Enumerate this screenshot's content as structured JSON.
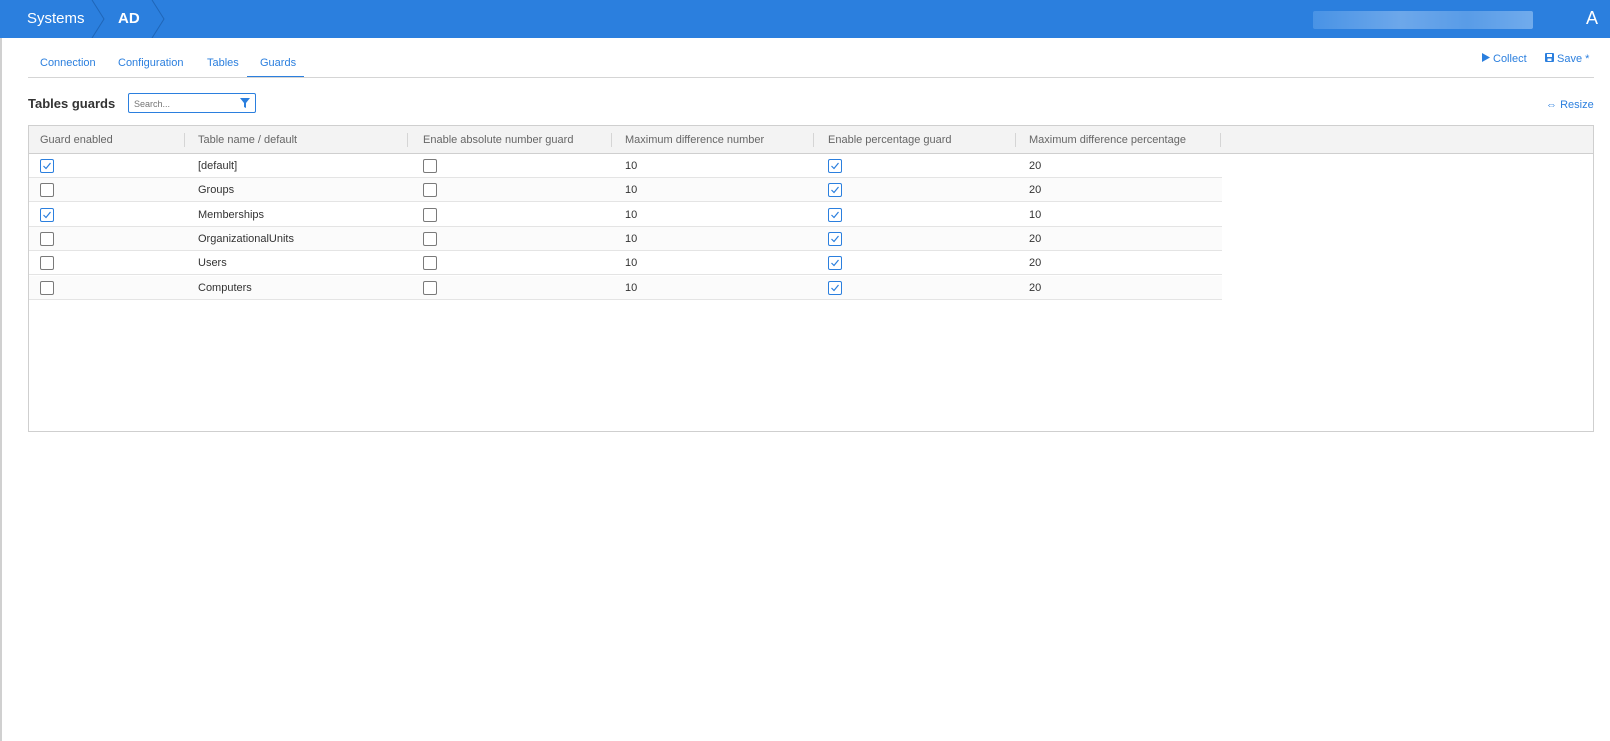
{
  "header": {
    "breadcrumb": [
      "Systems",
      "AD"
    ],
    "avatar_initial": "A"
  },
  "tabs": [
    {
      "label": "Connection",
      "active": false
    },
    {
      "label": "Configuration",
      "active": false
    },
    {
      "label": "Tables",
      "active": false
    },
    {
      "label": "Guards",
      "active": true
    }
  ],
  "actions": {
    "collect_label": "Collect",
    "save_label": "Save *",
    "collect_icon": "play-icon",
    "save_icon": "floppy-disk-icon"
  },
  "section": {
    "title": "Tables guards",
    "search_placeholder": "Search...",
    "filter_icon": "filter-icon",
    "resize_label": "Resize",
    "resize_icon": "horizontal-arrows-icon"
  },
  "table": {
    "columns": [
      "Guard enabled",
      "Table name / default",
      "Enable absolute number guard",
      "Maximum difference number",
      "Enable percentage guard",
      "Maximum difference percentage"
    ],
    "rows": [
      {
        "guard_enabled": true,
        "name": "[default]",
        "abs_guard": false,
        "max_diff_number": "10",
        "pct_guard": true,
        "max_diff_pct": "20"
      },
      {
        "guard_enabled": false,
        "name": "Groups",
        "abs_guard": false,
        "max_diff_number": "10",
        "pct_guard": true,
        "max_diff_pct": "20"
      },
      {
        "guard_enabled": true,
        "name": "Memberships",
        "abs_guard": false,
        "max_diff_number": "10",
        "pct_guard": true,
        "max_diff_pct": "10"
      },
      {
        "guard_enabled": false,
        "name": "OrganizationalUnits",
        "abs_guard": false,
        "max_diff_number": "10",
        "pct_guard": true,
        "max_diff_pct": "20"
      },
      {
        "guard_enabled": false,
        "name": "Users",
        "abs_guard": false,
        "max_diff_number": "10",
        "pct_guard": true,
        "max_diff_pct": "20"
      },
      {
        "guard_enabled": false,
        "name": "Computers",
        "abs_guard": false,
        "max_diff_number": "10",
        "pct_guard": true,
        "max_diff_pct": "20"
      }
    ]
  },
  "colors": {
    "accent": "#2b7fde",
    "header_bg": "#2b7fde"
  }
}
